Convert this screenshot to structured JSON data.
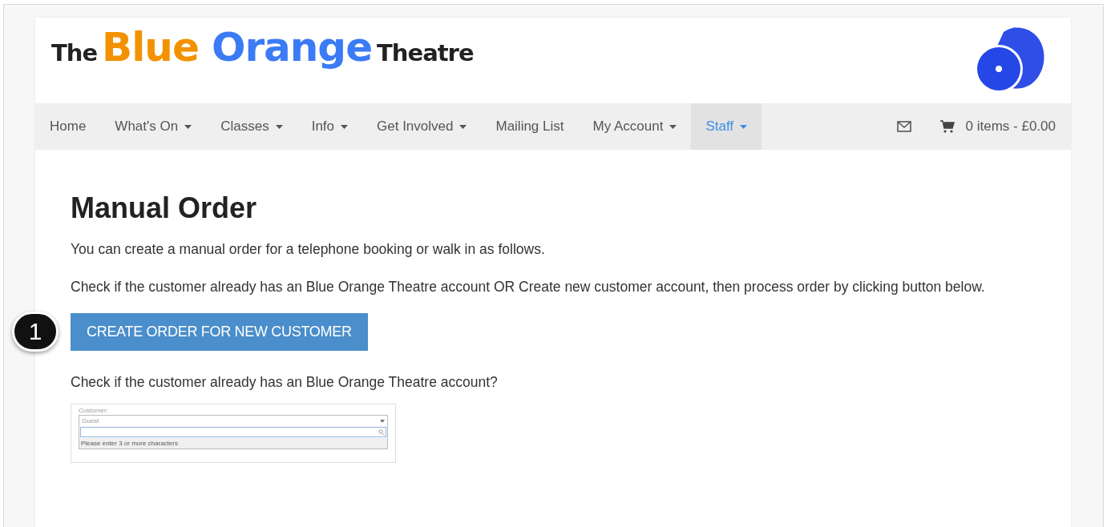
{
  "logo": {
    "parts": [
      {
        "text": "The",
        "kind": "small"
      },
      {
        "text": "Blue",
        "kind": "orange"
      },
      {
        "text": "Orange",
        "kind": "blue"
      },
      {
        "text": "Theatre",
        "kind": "small"
      }
    ]
  },
  "nav": {
    "items": [
      {
        "label": "Home",
        "dropdown": false,
        "selected": false
      },
      {
        "label": "What's On",
        "dropdown": true,
        "selected": false
      },
      {
        "label": "Classes",
        "dropdown": true,
        "selected": false
      },
      {
        "label": "Info",
        "dropdown": true,
        "selected": false
      },
      {
        "label": "Get Involved",
        "dropdown": true,
        "selected": false
      },
      {
        "label": "Mailing List",
        "dropdown": false,
        "selected": false
      },
      {
        "label": "My Account",
        "dropdown": true,
        "selected": false
      },
      {
        "label": "Staff",
        "dropdown": true,
        "selected": true
      }
    ],
    "cart": "0 items - £0.00"
  },
  "content": {
    "title": "Manual Order",
    "intro": "You can create a manual order for a telephone booking or walk in as follows.",
    "instructions": "Check if the customer already has an Blue Orange Theatre account OR Create new customer account, then process order by clicking button below.",
    "callout": "1",
    "button": "CREATE ORDER FOR NEW CUSTOMER",
    "check_text": "Check if the customer already has an Blue Orange Theatre account?",
    "embedded": {
      "label": "Customer:",
      "value": "Guest",
      "hint": "Please enter 3 or more characters"
    }
  }
}
